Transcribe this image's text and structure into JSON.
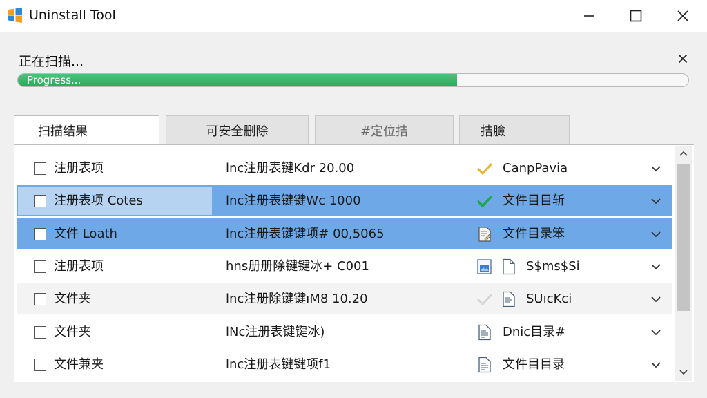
{
  "window": {
    "title": "Uninstall Tool",
    "app_icon": "windows-logo-icon",
    "controls": [
      "minimize-icon",
      "maximize-icon",
      "close-icon"
    ]
  },
  "scan": {
    "title": "正在扫描...",
    "progress_label": "Progress...",
    "progress_fraction": 0.655,
    "progress_color": "#35ad62"
  },
  "tabs": [
    {
      "label": "扫描结果",
      "active": true
    },
    {
      "label": "可安全删除",
      "active": false
    },
    {
      "label": "#定位拮",
      "active": false
    },
    {
      "label": "拮臉",
      "active": false
    }
  ],
  "rows": [
    {
      "name": "注册表项",
      "value": "lnc注册表键Kdr 20.00",
      "icons": [
        "checkmark-yellow-icon"
      ],
      "status": "CanpPavia"
    },
    {
      "name": "注册表项 Cotes",
      "value": "lnc注册表键键Wc 1000",
      "icons": [
        "checkmark-green-icon"
      ],
      "status": "文件目目斩"
    },
    {
      "name": "文件 Loath",
      "value": "lnc注册表键键项# 00,5065",
      "icons": [
        "document-edit-icon"
      ],
      "status": "文件目录笨"
    },
    {
      "name": "注册表项",
      "value": "hns册册除键键冰+ C001",
      "icons": [
        "image-file-icon",
        "document-icon"
      ],
      "status": "S$ms$Si"
    },
    {
      "name": "文件夹",
      "value": "lnc注册除键键ıM8 10.20",
      "icons": [
        "checkmark-faded-icon",
        "text-file-icon"
      ],
      "status": "SUıcKci"
    },
    {
      "name": "文件夹",
      "value": "lNc注册表键键冰)",
      "icons": [
        "text-file-icon"
      ],
      "status": "Dnic目录#"
    },
    {
      "name": "文件兼夹",
      "value": "lnc注册表键键项f1",
      "icons": [
        "text-file-icon"
      ],
      "status": "文件目目录"
    }
  ],
  "colors": {
    "selected_row": "#6fa8e6",
    "selected_cell": "#b7d3f2",
    "alt_row": "#f3f3f3",
    "check_green": "#1ea64a",
    "check_yellow": "#e5b42b"
  }
}
